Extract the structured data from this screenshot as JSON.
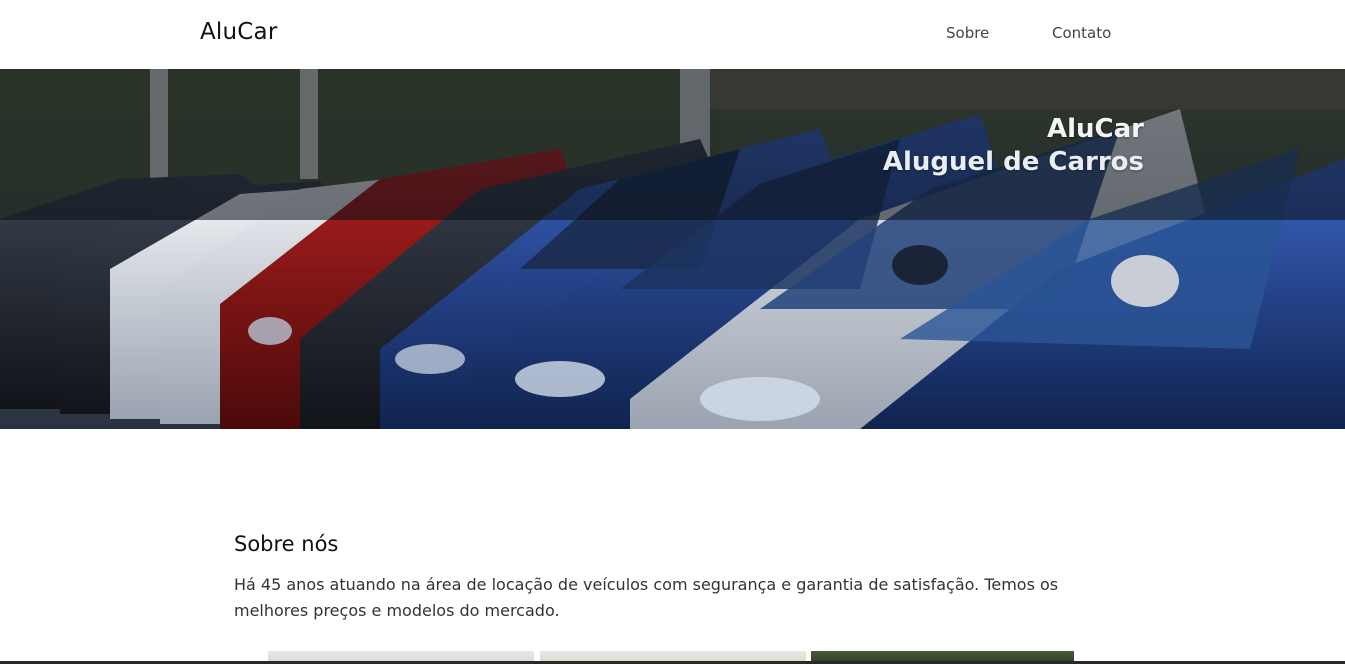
{
  "header": {
    "logo": "AluCar",
    "nav": [
      {
        "label": "Sobre"
      },
      {
        "label": "Contato"
      }
    ]
  },
  "hero": {
    "title": "AluCar",
    "subtitle": "Aluguel de Carros"
  },
  "about": {
    "title": "Sobre nós",
    "text": "Há 45 anos atuando na área de locação de veículos com segurança e garantia de satisfação. Temos os melhores preços e modelos do mercado."
  },
  "colors": {
    "background": "#ffffff",
    "text": "#222222",
    "hero_overlay": "#0a0e16"
  }
}
